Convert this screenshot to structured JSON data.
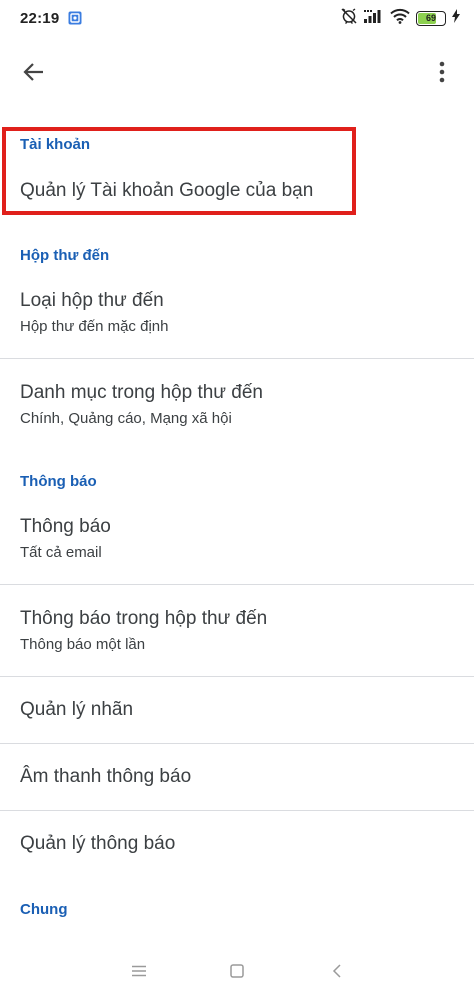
{
  "status_bar": {
    "time": "22:19",
    "battery_level": "69",
    "battery_fraction": 0.69
  },
  "app_bar": {
    "back_icon": "arrow-left-icon",
    "menu_icon": "more-vert-icon"
  },
  "account": {
    "header": "Tài khoản",
    "manage_label": "Quản lý Tài khoản Google của bạn"
  },
  "inbox": {
    "header": "Hộp thư đến",
    "inbox_type_title": "Loại hộp thư đến",
    "inbox_type_value": "Hộp thư đến mặc định",
    "categories_title": "Danh mục trong hộp thư đến",
    "categories_value": "Chính, Quảng cáo, Mạng xã hội"
  },
  "notifications": {
    "header": "Thông báo",
    "notifications_title": "Thông báo",
    "notifications_value": "Tất cả email",
    "inbox_notifications_title": "Thông báo trong hộp thư đến",
    "inbox_notifications_value": "Thông báo một lần",
    "manage_labels": "Quản lý nhãn",
    "notification_sound": "Âm thanh thông báo",
    "manage_notifications": "Quản lý thông báo"
  },
  "general": {
    "header": "Chung"
  },
  "colors": {
    "accent": "#1a5fb4",
    "highlight": "#e0201b",
    "battery": "#8dd150"
  }
}
